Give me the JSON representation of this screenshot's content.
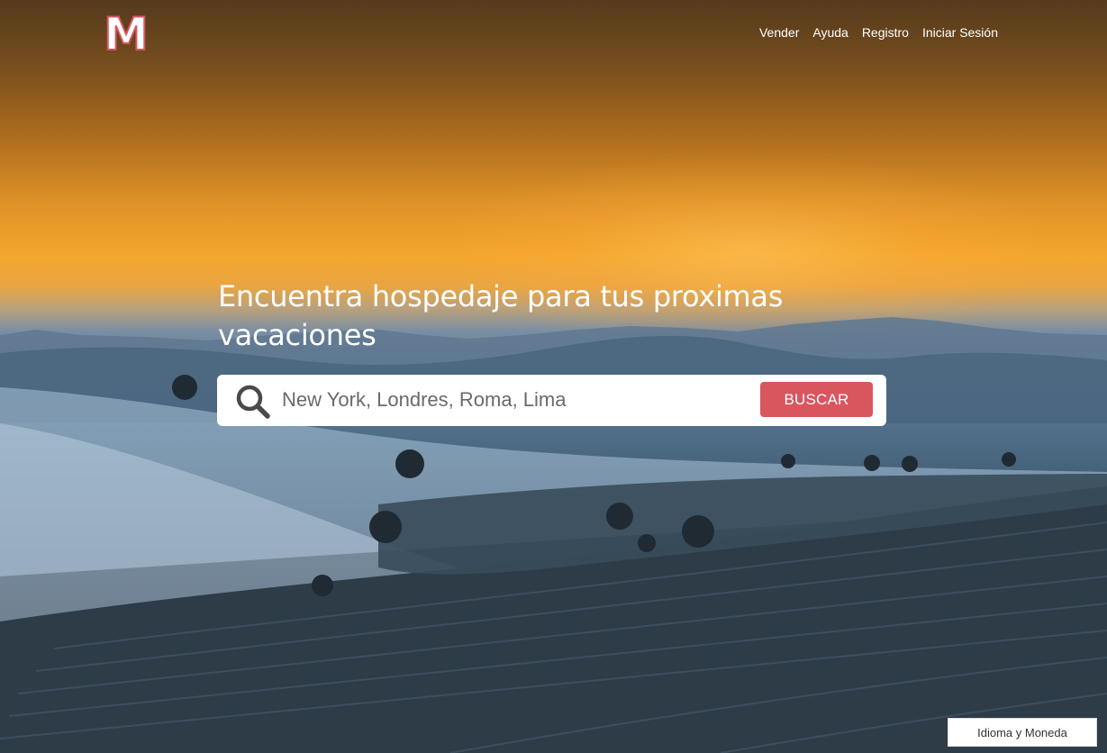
{
  "brand": {
    "logo_letter": "M",
    "logo_color": "#ffffff",
    "logo_outline": "#d9565f"
  },
  "nav": {
    "items": [
      {
        "label": "Vender"
      },
      {
        "label": "Ayuda"
      },
      {
        "label": "Registro"
      },
      {
        "label": "Iniciar Sesión"
      }
    ]
  },
  "hero": {
    "headline": "Encuentra hospedaje para tus proximas vacaciones",
    "background": "sunset-over-misty-hills"
  },
  "search": {
    "icon": "search-icon",
    "placeholder": "New York, Londres, Roma, Lima",
    "value": "",
    "button_label": "BUSCAR",
    "button_color": "#d9565f"
  },
  "footer": {
    "language_currency_label": "Idioma y Moneda"
  }
}
